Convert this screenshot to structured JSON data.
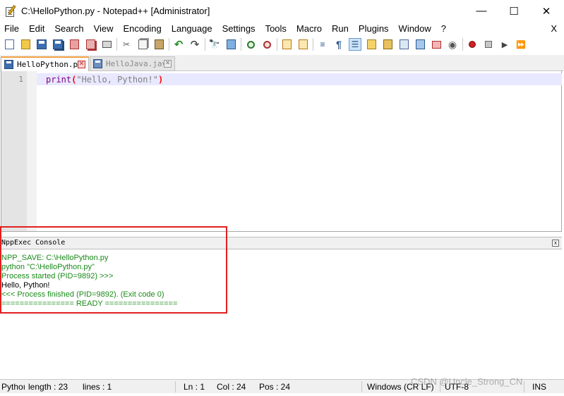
{
  "window": {
    "title": "C:\\HelloPython.py - Notepad++ [Administrator]",
    "minimize": "—",
    "maximize": "☐",
    "close": "✕"
  },
  "menu": {
    "items": [
      "File",
      "Edit",
      "Search",
      "View",
      "Encoding",
      "Language",
      "Settings",
      "Tools",
      "Macro",
      "Run",
      "Plugins",
      "Window",
      "?"
    ],
    "close": "X"
  },
  "toolbar": {
    "icons": [
      "new-file-icon",
      "open-file-icon",
      "save-icon",
      "save-all-icon",
      "close-icon",
      "close-all-icon",
      "print-icon",
      "cut-icon",
      "copy-icon",
      "paste-icon",
      "undo-icon",
      "redo-icon",
      "find-icon",
      "replace-icon",
      "zoom-in-icon",
      "zoom-out-icon",
      "sync-vertical-icon",
      "sync-horizontal-icon",
      "word-wrap-icon",
      "show-all-chars-icon",
      "indent-guide-icon",
      "udl-icon",
      "doc-map-icon",
      "function-list-icon",
      "folder-workspace-icon",
      "monitoring-icon",
      "record-macro-icon",
      "stop-record-icon",
      "play-macro-icon",
      "run-multiple-macro-icon"
    ]
  },
  "tabs": [
    {
      "label": "HelloPython.py",
      "active": true
    },
    {
      "label": "HelloJava.java",
      "active": false
    }
  ],
  "editor": {
    "line_number": "1",
    "code": {
      "keyword": "print",
      "open_paren": "(",
      "string": "\"Hello, Python!\"",
      "close_paren": ")"
    }
  },
  "console": {
    "title": "NppExec Console",
    "close": "x",
    "lines": [
      {
        "text": "NPP_SAVE: C:\\HelloPython.py",
        "color": "#1a8a1a"
      },
      {
        "text": "python \"C:\\HelloPython.py\"",
        "color": "#1a8a1a"
      },
      {
        "text": "Process started (PID=9892) >>>",
        "color": "#1a8a1a"
      },
      {
        "text": "Hello, Python!",
        "color": "#000000"
      },
      {
        "text": "<<< Process finished (PID=9892). (Exit code 0)",
        "color": "#1a8a1a"
      },
      {
        "text": "================ READY ================",
        "color": "#1a8a1a"
      }
    ]
  },
  "statusbar": {
    "file_type": "Pythoı",
    "length": "length : 23",
    "lines": "lines : 1",
    "ln": "Ln : 1",
    "col": "Col : 24",
    "pos": "Pos : 24",
    "eol": "Windows (CR LF)",
    "encoding": "UTF-8",
    "mode": "INS"
  },
  "watermark": "CSDN @Uncle_Strong_CN"
}
